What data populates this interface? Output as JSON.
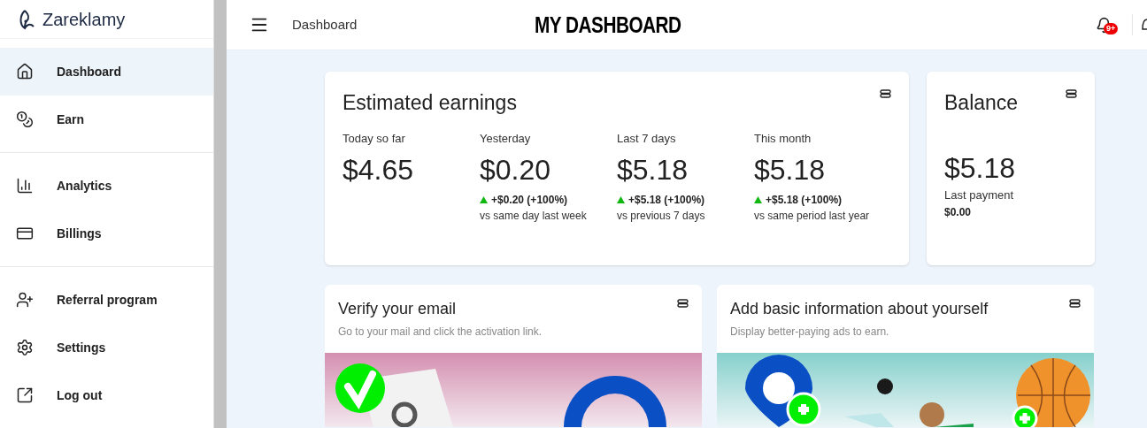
{
  "brand": {
    "name": "Zareklamy"
  },
  "sidebar": {
    "groups": [
      [
        {
          "label": "Dashboard",
          "selected": true
        },
        {
          "label": "Earn",
          "selected": false
        }
      ],
      [
        {
          "label": "Analytics",
          "selected": false
        },
        {
          "label": "Billings",
          "selected": false
        }
      ],
      [
        {
          "label": "Referral program",
          "selected": false
        },
        {
          "label": "Settings",
          "selected": false
        },
        {
          "label": "Log out",
          "selected": false
        }
      ]
    ]
  },
  "header": {
    "breadcrumb": "Dashboard",
    "title": "MY DASHBOARD",
    "notification_badge": "9+"
  },
  "earnings": {
    "title": "Estimated earnings",
    "stats": [
      {
        "label": "Today so far",
        "value": "$4.65"
      },
      {
        "label": "Yesterday",
        "value": "$0.20",
        "change": "+$0.20 (+100%)",
        "compare": "vs same day last week"
      },
      {
        "label": "Last 7 days",
        "value": "$5.18",
        "change": "+$5.18 (+100%)",
        "compare": "vs previous 7 days"
      },
      {
        "label": "This month",
        "value": "$5.18",
        "change": "+$5.18 (+100%)",
        "compare": "vs same period last year"
      }
    ]
  },
  "balance": {
    "title": "Balance",
    "value": "$5.18",
    "last_payment_label": "Last payment",
    "last_payment": "$0.00"
  },
  "tasks": [
    {
      "title": "Verify your email",
      "subtitle": "Go to your mail and click the activation link.",
      "kind": "email"
    },
    {
      "title": "Add basic information about yourself",
      "subtitle": "Display better-paying ads to earn.",
      "kind": "profile"
    }
  ]
}
